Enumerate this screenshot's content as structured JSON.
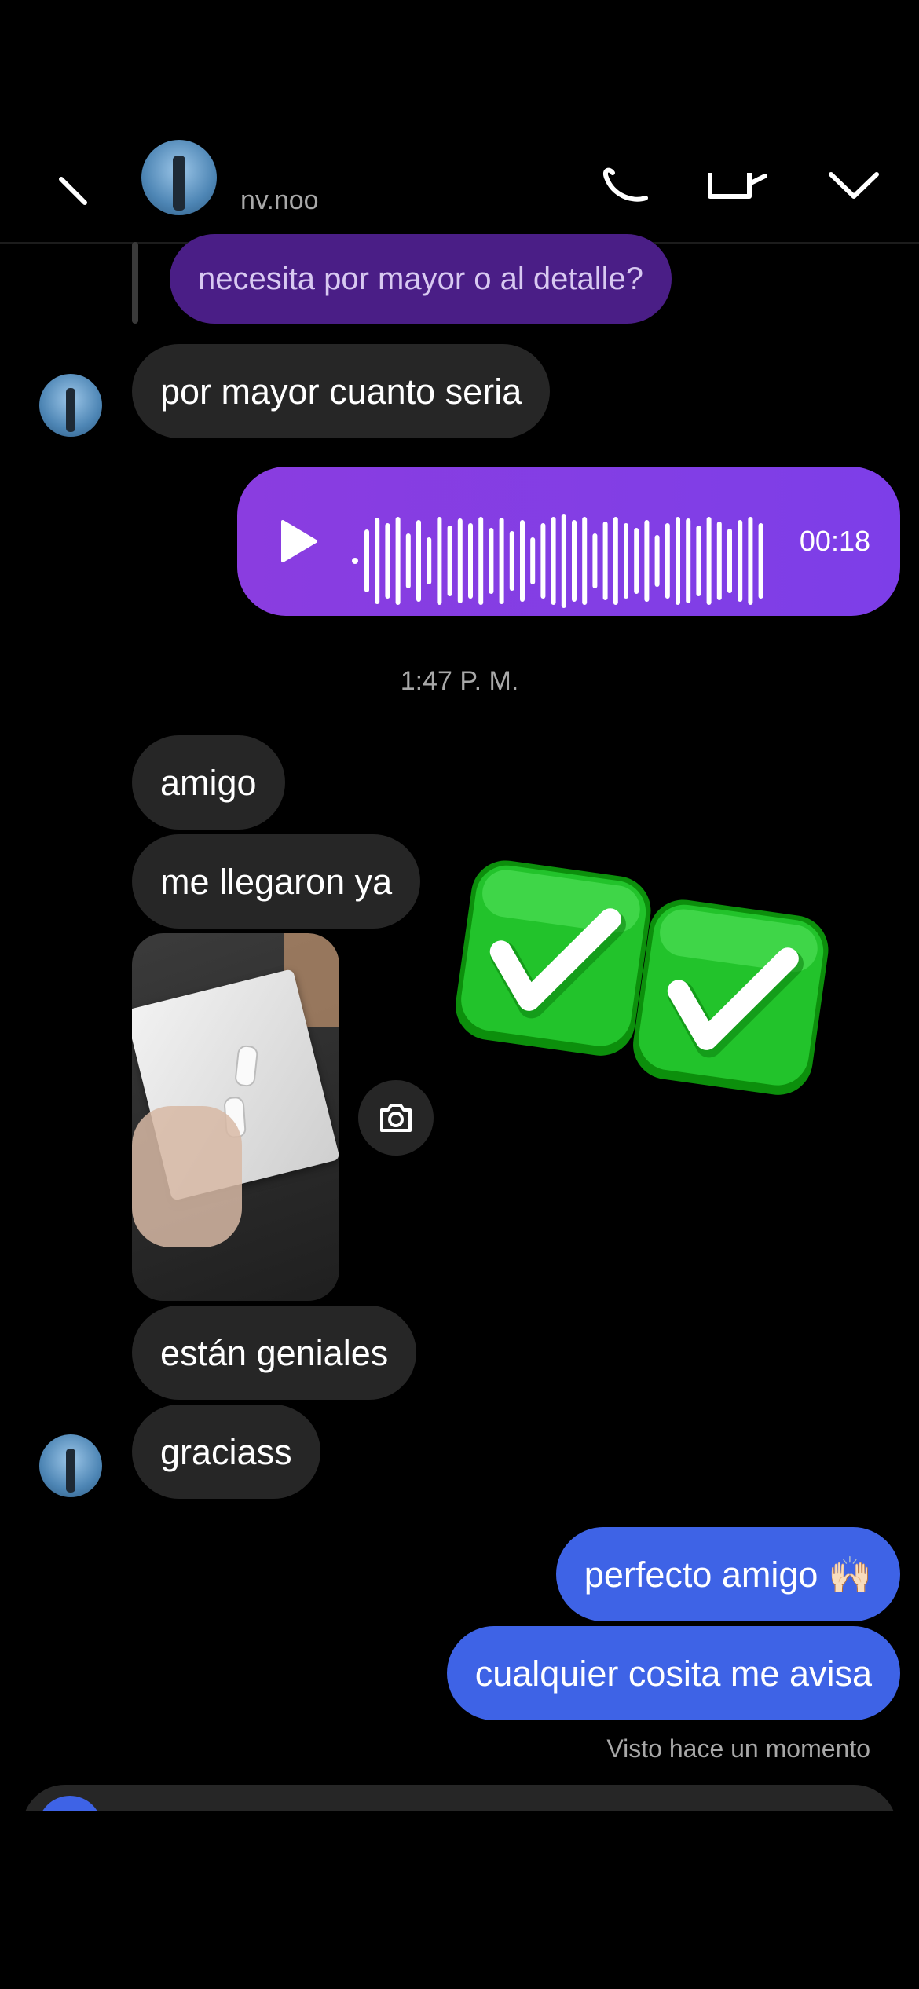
{
  "header": {
    "username": "nv.noo",
    "icons": [
      "back-chevron-icon",
      "avatar",
      "phone-icon",
      "video-icon",
      "chevron-down-icon"
    ]
  },
  "messages": {
    "reply_preview": "necesita por mayor o al detalle?",
    "m1": "por mayor cuanto seria",
    "voice": {
      "duration": "00:18"
    },
    "timestamp": "1:47 P. M.",
    "m2": "amigo",
    "m3": "me llegaron ya",
    "emoji_reaction": "✅✅",
    "m4": "están geniales",
    "m5": "graciass",
    "m6": "perfecto amigo 🙌🏻",
    "m7": "cualquier cosita me avisa",
    "seen": "Visto hace un momento"
  },
  "colors": {
    "background": "#000000",
    "incoming_bubble": "#262626",
    "outgoing_blue": "#3e63e6",
    "voice_purple": "#8a3de0",
    "reply_purple": "#4a1e86",
    "muted_text": "#a8a8a8"
  }
}
